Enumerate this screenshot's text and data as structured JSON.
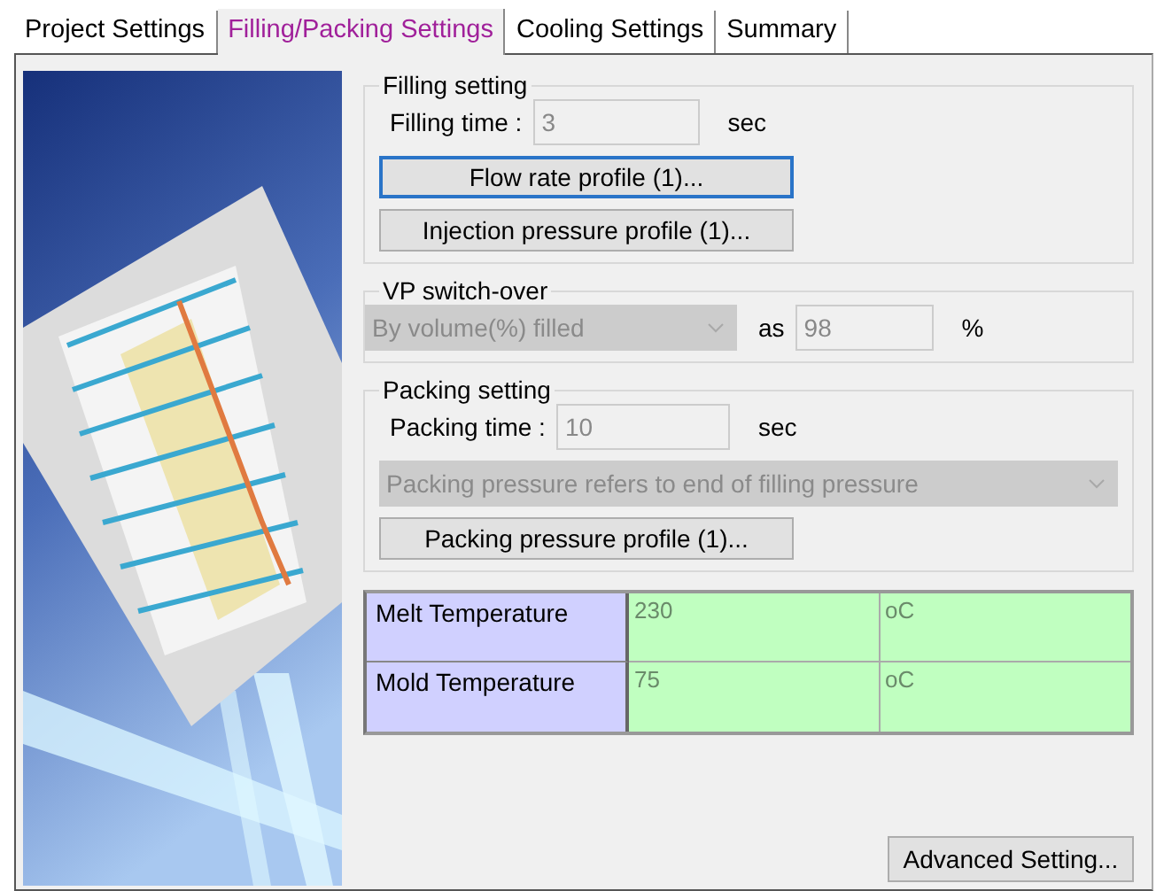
{
  "tabs": [
    {
      "label": "Project Settings",
      "selected": false
    },
    {
      "label": "Filling/Packing Settings",
      "selected": true
    },
    {
      "label": "Cooling Settings",
      "selected": false
    },
    {
      "label": "Summary",
      "selected": false
    }
  ],
  "filling_setting": {
    "title": "Filling setting",
    "time": {
      "label": "Filling time :",
      "value": "3",
      "unit": "sec",
      "disabled": true
    },
    "buttons": [
      {
        "label": "Flow rate profile (1)...",
        "focused": true
      },
      {
        "label": "Injection pressure profile (1)...",
        "focused": false
      }
    ]
  },
  "vp_switch_over": {
    "title": "VP switch-over",
    "mode": {
      "value": "By volume(%) filled",
      "disabled": true
    },
    "as_label": "as",
    "amount": {
      "value": "98",
      "disabled": true
    },
    "unit": "%"
  },
  "packing_setting": {
    "title": "Packing setting",
    "time": {
      "label": "Packing time :",
      "value": "10",
      "unit": "sec",
      "disabled": true
    },
    "reference": {
      "value": "Packing pressure refers to end of filling pressure",
      "disabled": true
    },
    "buttons": [
      {
        "label": "Packing pressure profile (1)...",
        "focused": false
      }
    ]
  },
  "temperatures": [
    {
      "name": "Melt Temperature",
      "value": "230",
      "unit": "oC"
    },
    {
      "name": "Mold Temperature",
      "value": "75",
      "unit": "oC"
    }
  ],
  "advanced_button": {
    "label": "Advanced Setting..."
  }
}
